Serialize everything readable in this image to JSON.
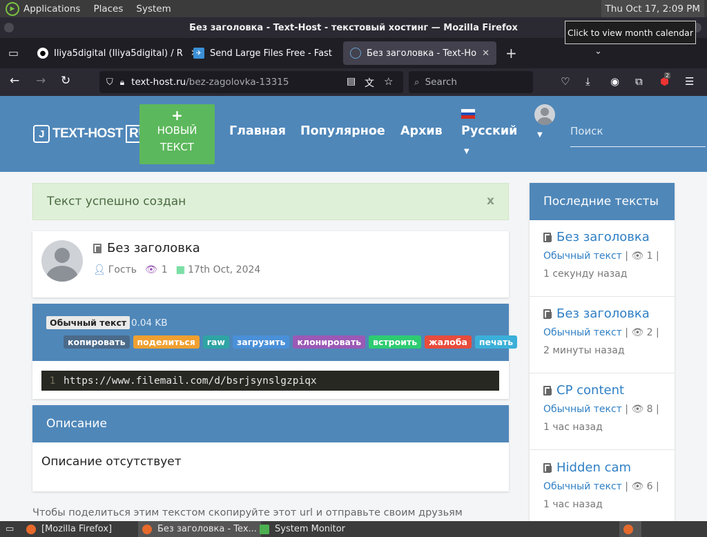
{
  "system": {
    "menus": [
      "Applications",
      "Places",
      "System"
    ],
    "clock": "Thu Oct 17,  2:09 PM",
    "tooltip": "Click to view month calendar"
  },
  "window": {
    "title": "Без заголовка - Text-Host - текстовый хостинг — Mozilla Firefox"
  },
  "tabs": [
    {
      "title": "Iliya5digital (Iliya5digital) / R",
      "icon": "github-icon",
      "active": false
    },
    {
      "title": "Send Large Files Free - Fast",
      "icon": "filemail-icon",
      "active": false
    },
    {
      "title": "Без заголовка - Text-Host",
      "icon": "texthost-icon",
      "active": true
    }
  ],
  "navbar": {
    "url_domain": "text-host.ru",
    "url_path": "/bez-zagolovka-13315",
    "search_placeholder": "Search",
    "badge_count": "2"
  },
  "site": {
    "brand_text": "TEXT-HOST",
    "brand_suffix": "RU",
    "new_button": "НОВЫЙ ТЕКСТ",
    "nav": [
      "Главная",
      "Популярное",
      "Архив",
      "Русский"
    ],
    "search_placeholder": "Поиск"
  },
  "alert": {
    "text": "Текст успешно создан",
    "close": "x"
  },
  "document": {
    "title": "Без заголовка",
    "author": "Гость",
    "views": "1",
    "date": "17th Oct, 2024",
    "syntax": "Обычный текст",
    "size": "0.04 KB",
    "actions": [
      {
        "label": "копировать",
        "color": "#4a6a8a"
      },
      {
        "label": "поделиться",
        "color": "#f0ad4e"
      },
      {
        "label": "raw",
        "color": "#2fa4a4"
      },
      {
        "label": "загрузить",
        "color": "#4a90d9"
      },
      {
        "label": "клонировать",
        "color": "#9b59b6"
      },
      {
        "label": "встроить",
        "color": "#2ecc71"
      },
      {
        "label": "жалоба",
        "color": "#e74c3c"
      },
      {
        "label": "печать",
        "color": "#3bb0d9"
      }
    ],
    "line_number": "1",
    "code": "https://www.filemail.com/d/bsrjsynslgzpiqx"
  },
  "description": {
    "heading": "Описание",
    "body": "Описание отсутствует"
  },
  "share_note": "Чтобы поделиться этим текстом скопируйте этот url и отправьте своим друзьям",
  "sidebar": {
    "heading": "Последние тексты",
    "items": [
      {
        "title": "Без заголовка",
        "syntax": "Обычный текст",
        "views": "1",
        "time": "1 секунду назад"
      },
      {
        "title": "Без заголовка",
        "syntax": "Обычный текст",
        "views": "2",
        "time": "2 минуты назад"
      },
      {
        "title": "CP content",
        "syntax": "Обычный текст",
        "views": "8",
        "time": "1 час назад"
      },
      {
        "title": "Hidden cam",
        "syntax": "Обычный текст",
        "views": "6",
        "time": "1 час назад"
      }
    ]
  },
  "taskbar": {
    "items": [
      "[Mozilla Firefox]",
      "Без заголовка - Tex...",
      "System Monitor"
    ]
  }
}
